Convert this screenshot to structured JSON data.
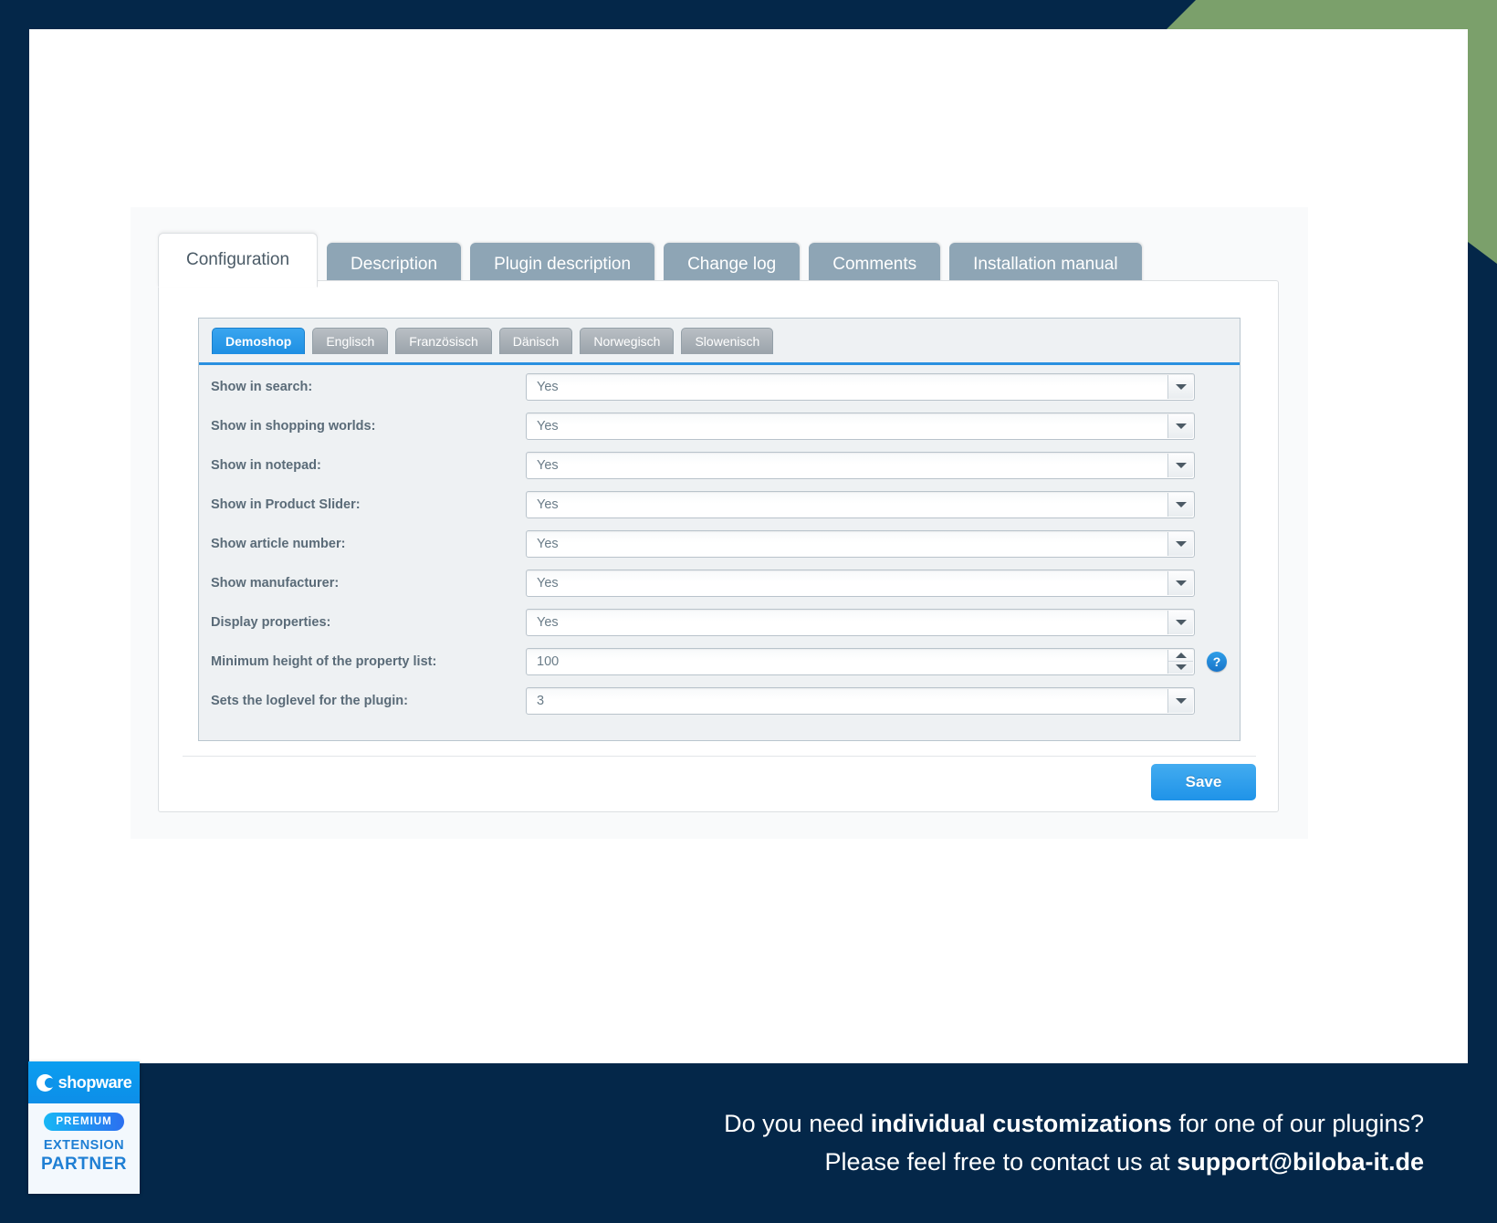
{
  "decor": {
    "frame_color": "#042749",
    "accent_green": "#7ba06b"
  },
  "tabs": [
    {
      "label": "Configuration",
      "active": true
    },
    {
      "label": "Description",
      "active": false
    },
    {
      "label": "Plugin description",
      "active": false
    },
    {
      "label": "Change log",
      "active": false
    },
    {
      "label": "Comments",
      "active": false
    },
    {
      "label": "Installation manual",
      "active": false
    }
  ],
  "language_tabs": [
    {
      "label": "Demoshop",
      "active": true
    },
    {
      "label": "Englisch",
      "active": false
    },
    {
      "label": "Französisch",
      "active": false
    },
    {
      "label": "Dänisch",
      "active": false
    },
    {
      "label": "Norwegisch",
      "active": false
    },
    {
      "label": "Slowenisch",
      "active": false
    }
  ],
  "form": {
    "rows": [
      {
        "label": "Show in search:",
        "value": "Yes",
        "control": "select"
      },
      {
        "label": "Show in shopping worlds:",
        "value": "Yes",
        "control": "select"
      },
      {
        "label": "Show in notepad:",
        "value": "Yes",
        "control": "select"
      },
      {
        "label": "Show in Product Slider:",
        "value": "Yes",
        "control": "select"
      },
      {
        "label": "Show article number:",
        "value": "Yes",
        "control": "select"
      },
      {
        "label": "Show manufacturer:",
        "value": "Yes",
        "control": "select"
      },
      {
        "label": "Display properties:",
        "value": "Yes",
        "control": "select"
      },
      {
        "label": "Minimum height of the property list:",
        "value": "100",
        "control": "spinner",
        "help": "?"
      },
      {
        "label": "Sets the loglevel for the plugin:",
        "value": "3",
        "control": "select"
      }
    ]
  },
  "actions": {
    "save_label": "Save"
  },
  "badge": {
    "wordmark": "shopware",
    "premium": "PREMIUM",
    "extension": "EXTENSION",
    "partner": "PARTNER"
  },
  "cta": {
    "line1_a": "Do you need ",
    "line1_b": "individual customizations",
    "line1_c": " for one of our plugins?",
    "line2_a": "Please feel free to contact us at ",
    "line2_b": "support@biloba-it.de"
  }
}
